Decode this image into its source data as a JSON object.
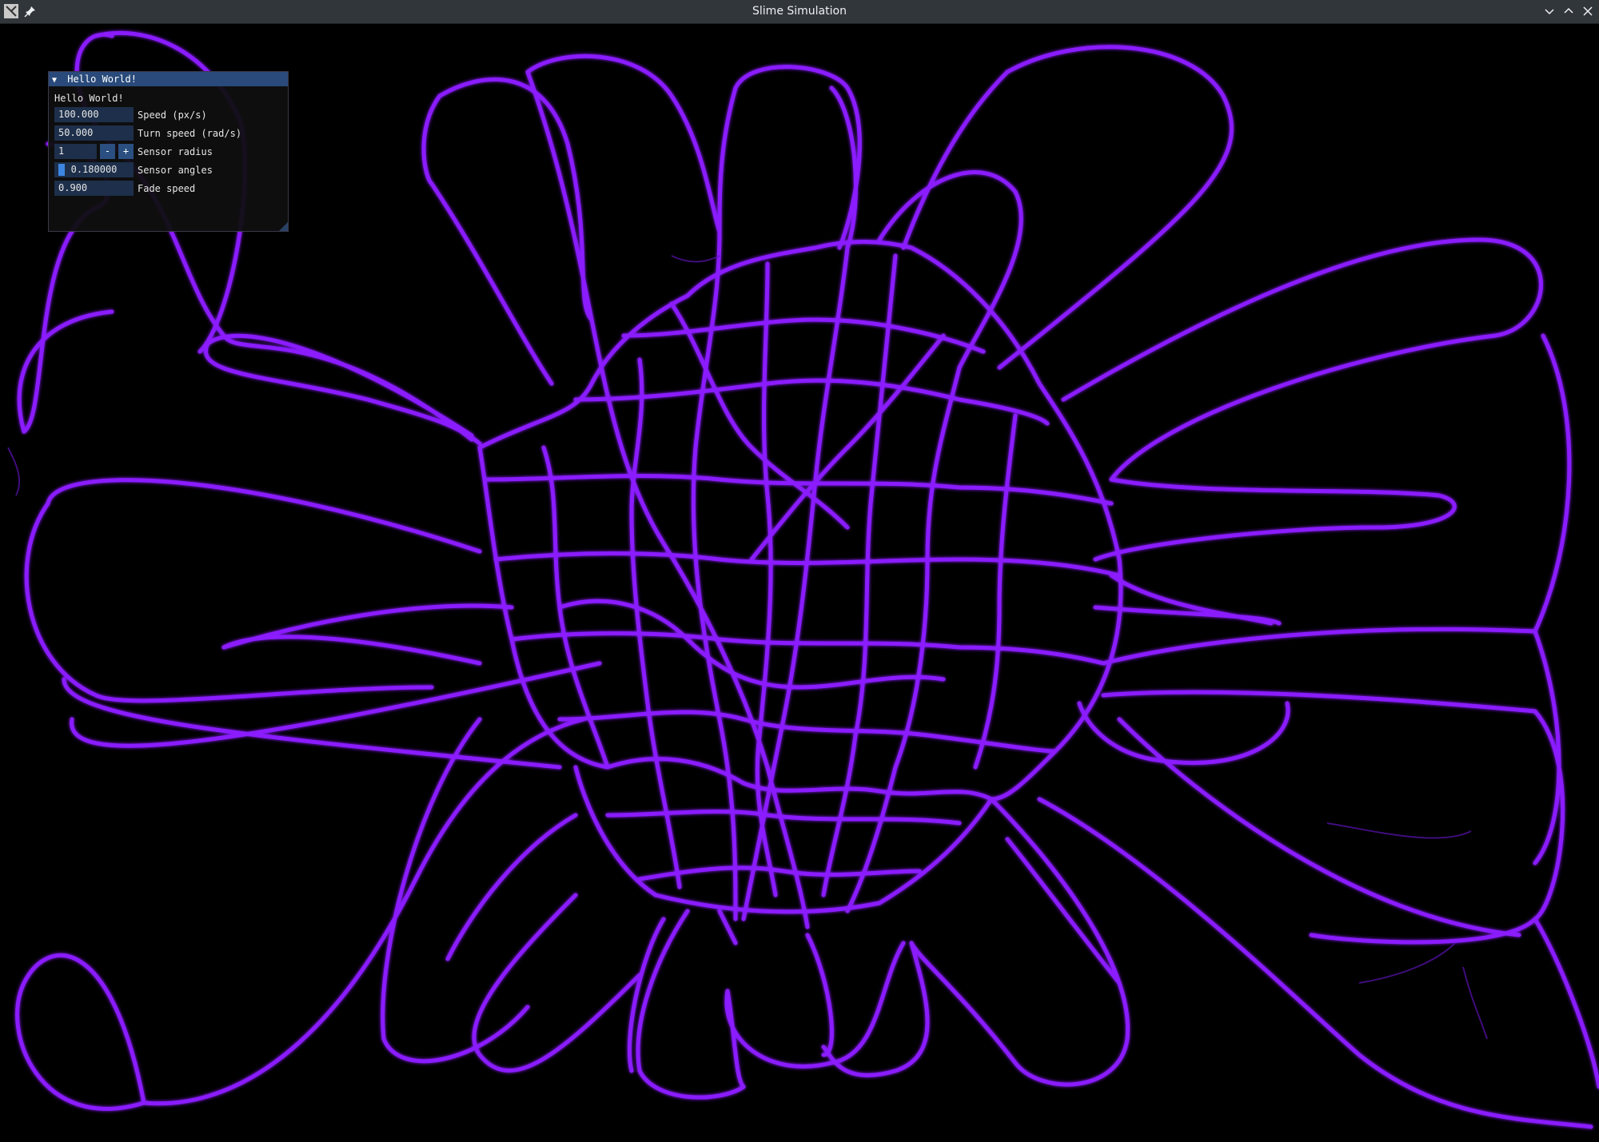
{
  "window": {
    "title": "Slime Simulation"
  },
  "titlebar_icons": {
    "app": "x-app-icon",
    "pin": "pin-icon",
    "minimize": "chevron-down-icon",
    "maximize": "chevron-up-icon",
    "close": "close-icon"
  },
  "panel": {
    "title": "Hello World!",
    "text": "Hello World!",
    "speed": {
      "value": "100.000",
      "label": "Speed (px/s)"
    },
    "turn_speed": {
      "value": "50.000",
      "label": "Turn speed (rad/s)"
    },
    "sensor_radius": {
      "value": "1",
      "minus": "-",
      "plus": "+",
      "label": "Sensor radius"
    },
    "sensor_angles": {
      "value": "0.180000",
      "label": "Sensor angles",
      "fraction": 0.03
    },
    "fade_speed": {
      "value": "0.900",
      "label": "Fade speed"
    }
  },
  "colors": {
    "slime": "#8a1fff",
    "slime_glow": "#6a12d6",
    "background": "#000000",
    "titlebar": "#31363b",
    "panel_title": "#294a7a",
    "field": "#1d2f4a",
    "slider_grab": "#3d85e0"
  }
}
